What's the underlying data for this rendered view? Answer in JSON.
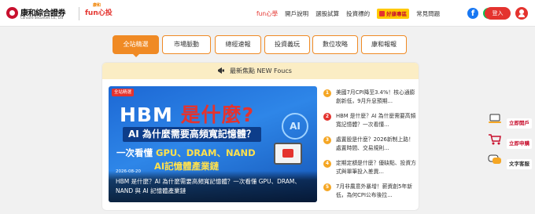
{
  "header": {
    "brand_name": "康和綜合證券",
    "brand_name_en": "Concord Securities Co., Ltd",
    "fun_logo": "fun心投",
    "fun_logo_small": "康和",
    "nav": [
      {
        "label": "fun心學",
        "active": true
      },
      {
        "label": "開戶說明",
        "active": false
      },
      {
        "label": "選股試算",
        "active": false
      },
      {
        "label": "投資標的",
        "active": false
      }
    ],
    "promo_label": "好康專區",
    "faq_label": "常見問題",
    "login_label": "登入",
    "icons": [
      "facebook-icon",
      "line-icon",
      "user-icon"
    ]
  },
  "tabs": [
    {
      "label": "全站精選",
      "active": true
    },
    {
      "label": "市場脈動",
      "active": false
    },
    {
      "label": "總經速報",
      "active": false
    },
    {
      "label": "投資義玩",
      "active": false
    },
    {
      "label": "數位攻略",
      "active": false
    },
    {
      "label": "康和報報",
      "active": false
    }
  ],
  "news": {
    "heading": "最新焦點 NEW Foucs",
    "feature": {
      "tag": "全站精選",
      "banner_title_a": "HBM",
      "banner_title_b": "是什麼?",
      "banner_line1": "AI 為什麼需要高頻寬記憶體？",
      "banner_line2_a": "一次看懂 ",
      "banner_line2_b": "GPU、DRAM、NAND",
      "banner_line3": "AI記憶體產業鏈",
      "banner_badge": "AI",
      "date": "2026-08-20",
      "title": "HBM 是什麼？AI 為什麼需要高頻寬記憶體？一次看懂 GPU、DRAM、NAND 與 AI 記憶體產業鏈"
    },
    "items": [
      {
        "num": "1",
        "color": "#f5a623",
        "text": "美國7月CPI降至3.4%！核心通膨創新低，9月升息預期..."
      },
      {
        "num": "2",
        "color": "#e4332e",
        "text": "HBM 是什麼？AI 為什麼需要高頻寬記憶體？一次看懂..."
      },
      {
        "num": "3",
        "color": "#f5a623",
        "text": "處置股是什麼？2026新制上路！處置時間、交易規則..."
      },
      {
        "num": "4",
        "color": "#f5a623",
        "text": "定期定額是什麼？優缺點、投資方式與單筆投入差異..."
      },
      {
        "num": "5",
        "color": "#f5a623",
        "text": "7月非農意外暴增！薪資創5年新低，為何CPI公布後拉..."
      }
    ]
  },
  "side": [
    {
      "label": "立即開戶",
      "icon": "laptop-icon"
    },
    {
      "label": "立即申購",
      "icon": "cart-icon"
    },
    {
      "label": "文字客服",
      "icon": "chat-icon"
    }
  ],
  "colors": {
    "brand_red": "#e4332e",
    "orange": "#f08a24",
    "focus_bg": "#fbedc4"
  }
}
